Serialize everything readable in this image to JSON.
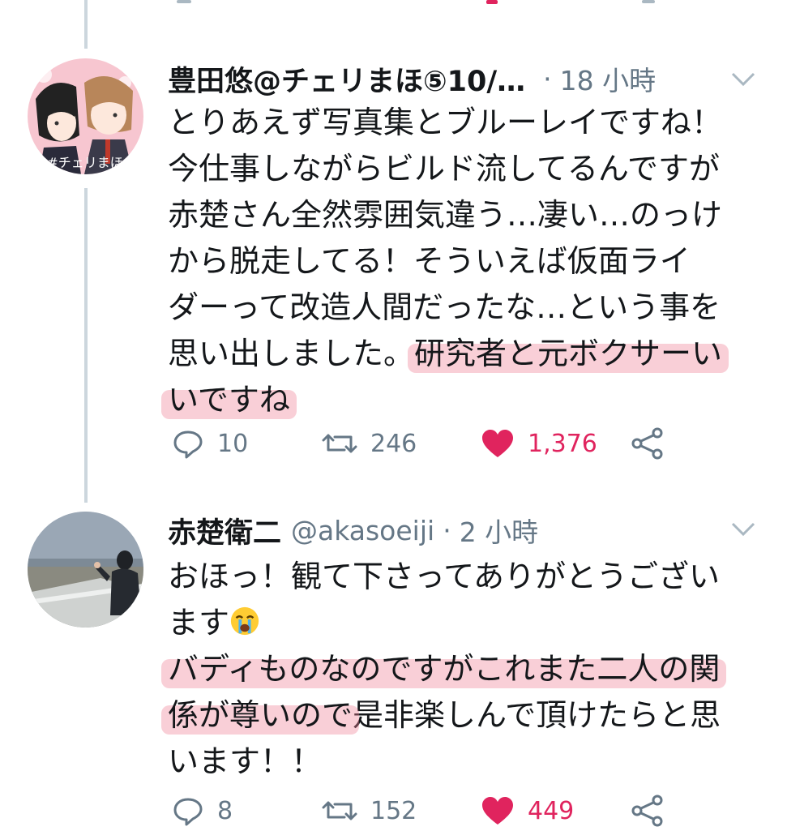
{
  "thread": [
    {
      "author_name": "豊田悠@チェリまほ⑤10/…",
      "handle": "",
      "separator": "·",
      "time": "18 小時",
      "avatar_label": "#チェリまほ",
      "lines": [
        [
          {
            "t": "とりあえず写真集とブルーレイですね！"
          }
        ],
        [
          {
            "t": "今仕事しながらビルド流してるんですが"
          }
        ],
        [
          {
            "t": "赤楚さん全然雰囲気違う…凄い…のっけ"
          }
        ],
        [
          {
            "t": "から脱走してる！そういえば仮面ライ"
          }
        ],
        [
          {
            "t": "ダーって改造人間だったな…という事を"
          }
        ],
        [
          {
            "t": "思い出しました。"
          },
          {
            "t": "研究者と元ボクサーい",
            "hl": true
          }
        ],
        [
          {
            "t": "いですね",
            "hl": true
          }
        ]
      ],
      "replies": "10",
      "retweets": "246",
      "likes": "1,376"
    },
    {
      "author_name": "赤楚衛二",
      "handle": "@akasoeiji",
      "separator": "·",
      "time": "2 小時",
      "lines": [
        [
          {
            "t": "おほっ！観て下さってありがとうござい"
          }
        ],
        [
          {
            "t": "ます"
          },
          {
            "emoji": "crying-face-icon"
          }
        ],
        [
          {
            "t": "バディものなのですがこれまた二人の関",
            "hl": true
          }
        ],
        [
          {
            "t": "係が尊いので",
            "hl": true
          },
          {
            "t": "是非楽しんで頂けたらと思"
          }
        ],
        [
          {
            "t": "います！！"
          }
        ]
      ],
      "replies": "8",
      "retweets": "152",
      "likes": "449"
    }
  ],
  "colors": {
    "text": "#14171a",
    "secondary": "#657786",
    "like": "#e0245e",
    "thread_line": "#ccd6dd",
    "highlight": "#f3a5b5"
  },
  "icons": [
    "reply-icon",
    "retweet-icon",
    "heart-icon",
    "share-icon",
    "chevron-down-icon"
  ]
}
